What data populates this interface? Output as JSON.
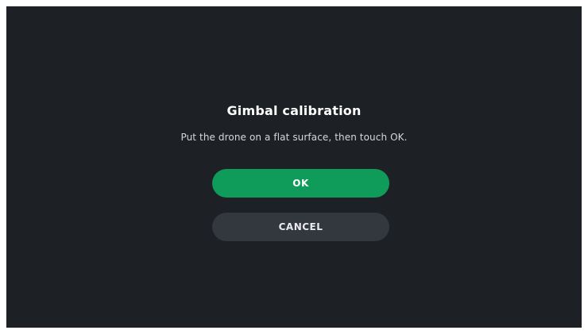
{
  "dialog": {
    "title": "Gimbal calibration",
    "message": "Put the drone on a flat surface, then touch OK.",
    "ok_label": "OK",
    "cancel_label": "CANCEL"
  },
  "colors": {
    "background": "#1d2025",
    "ok_button": "#0f9c5b",
    "cancel_button": "#33373e"
  }
}
